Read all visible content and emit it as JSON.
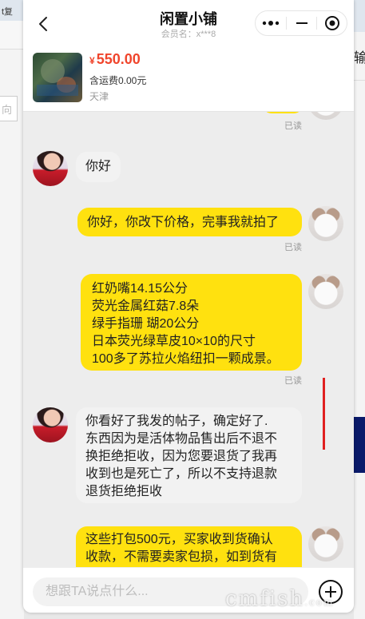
{
  "background": {
    "left_tab_text": "t复 ",
    "left_box_text": "向",
    "right_text": "输"
  },
  "header": {
    "title": "闲置小铺",
    "subtitle": "会员名：x***8",
    "back_icon": "chevron-left-icon",
    "capsule": [
      "more-dots-icon",
      "minimize-icon",
      "close-target-icon"
    ]
  },
  "product": {
    "currency": "¥",
    "price": "550.00",
    "shipping": "含运费0.00元",
    "location": "天津",
    "price_color": "#f0452c"
  },
  "messages": [
    {
      "side": "right",
      "text": "",
      "read": "已读",
      "partial": true
    },
    {
      "side": "left",
      "text": "你好",
      "read": ""
    },
    {
      "side": "right",
      "text": "你好，你改下价格，完事我就拍了",
      "read": "已读"
    },
    {
      "side": "right",
      "lines": [
        "红奶嘴14.15公分",
        "荧光金属红菇7.8朵",
        "绿手指珊 瑚20公分",
        "日本荧光绿草皮10×10的尺寸",
        "100多了苏拉火焰纽扣一颗成景。"
      ],
      "read": "已读"
    },
    {
      "side": "left",
      "lines": [
        "你看好了我发的帖子，确定好了.",
        "东西因为是活体物品售出后不退不",
        "换拒绝拒收，因为您要退货了我再",
        "收到也是死亡了，所以不支持退款",
        "退货拒绝拒收"
      ],
      "read": ""
    },
    {
      "side": "right",
      "lines": [
        "这些打包500元，买家收到货确认",
        "收款，不需要卖家包损，如到货有"
      ],
      "read": "",
      "partial": true
    }
  ],
  "input": {
    "placeholder": "想跟TA说点什么...",
    "value": ""
  },
  "watermark": {
    "text": "cmfish",
    "suffix": ".com"
  },
  "colors": {
    "bubble_right": "#ffe10f",
    "bubble_left": "#f2f2f2",
    "accent_red": "#e02020"
  }
}
